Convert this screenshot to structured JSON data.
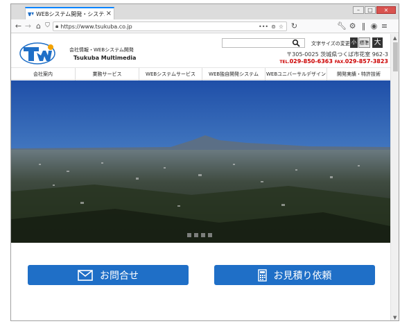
{
  "browser": {
    "tab_title": "WEBシステム開発・システム",
    "tab_close": "×",
    "url": "https://www.tsukuba.co.jp",
    "window_buttons": [
      "–",
      "□",
      "×"
    ]
  },
  "header": {
    "company_line1": "会社情報・WEBシステム開発",
    "company_line2": "Tsukuba Multimedia",
    "font_size_label": "文字サイズの変更",
    "font_size_small": "小",
    "font_size_medium": "標準",
    "font_size_large": "大",
    "address": "〒305-0025 茨城県つくば市花室 962-3",
    "tel_label": "TEL.",
    "tel": "029-850-6363",
    "fax_label": "FAX.",
    "fax": "029-857-3823"
  },
  "nav": {
    "items": [
      "会社案内",
      "業務サービス",
      "WEBシステムサービス",
      "WEB独自開発システム",
      "WEBユニバーサルデザイン",
      "開発実績・特許技術"
    ]
  },
  "cta": {
    "contact": "お問合せ",
    "estimate": "お見積り依頼"
  },
  "colors": {
    "accent": "#1f6fc7",
    "tab_accent": "#0a84ff",
    "tel_color": "#cc0000"
  }
}
